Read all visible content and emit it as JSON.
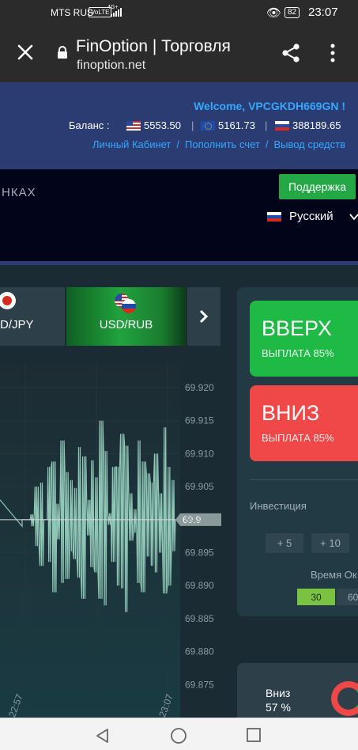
{
  "status_bar": {
    "carrier": "MTS RUS",
    "volte": "VoLTE",
    "network": "4G+",
    "battery": "82",
    "time": "23:07"
  },
  "browser": {
    "title": "FinOption | Торговля",
    "url": "finoption.net"
  },
  "header": {
    "welcome": "Welcome, VPCGKDH669GN !",
    "balance_label": "Баланс :",
    "balances": [
      {
        "currency_icon": "us-flag-icon",
        "value": "5553.50"
      },
      {
        "currency_icon": "eu-flag-icon",
        "value": "5161.73"
      },
      {
        "currency_icon": "ru-flag-icon",
        "value": "388189.65"
      }
    ],
    "links": [
      "Личный Кабинет",
      "Пополнить счет",
      "Вывод средств"
    ]
  },
  "banner": {
    "news_fragment": "НКАХ",
    "support_label": "Поддержка",
    "language": "Русский"
  },
  "pairs": {
    "previous": "D/JPY",
    "active": "USD/RUB"
  },
  "chart_data": {
    "type": "line",
    "series": [
      {
        "values": [
          69.9,
          69.9,
          69.899,
          69.905,
          69.893,
          69.9,
          69.908,
          69.889,
          69.897,
          69.912,
          69.891,
          69.906,
          69.894,
          69.911,
          69.888,
          69.903,
          69.909,
          69.892,
          69.915,
          69.887,
          69.901,
          69.908,
          69.89,
          69.913,
          69.886,
          69.904,
          69.898,
          69.912,
          69.889,
          69.907,
          69.893,
          69.91,
          69.895,
          69.914,
          69.89,
          69.906,
          69.9
        ]
      }
    ],
    "current_value": "69.9",
    "y_ticks": [
      "69.920",
      "69.915",
      "69.910",
      "69.905",
      "69.900",
      "69.895",
      "69.890",
      "69.885",
      "69.880",
      "69.875"
    ],
    "x_ticks": [
      "22:57",
      "23:07"
    ],
    "ylim": [
      69.873,
      69.923
    ]
  },
  "trade_panel": {
    "up_label": "ВВЕРХ",
    "up_payout": "ВЫПЛАТА 85%",
    "down_label": "ВНИЗ",
    "down_payout": "ВЫПЛАТА 85%",
    "investment_label": "Инвестиция",
    "steps": [
      "+ 5",
      "+ 10"
    ],
    "time_label": "Время Ок",
    "time_options": [
      "30",
      "60"
    ],
    "active_time": "30"
  },
  "stats": {
    "direction": "Вниз",
    "percent": "57 %"
  },
  "colors": {
    "up": "#1fba45",
    "down": "#f04848",
    "header_blue": "#2a3c72",
    "link_blue": "#35a7ff",
    "chart_line": "#8fc6b6"
  }
}
